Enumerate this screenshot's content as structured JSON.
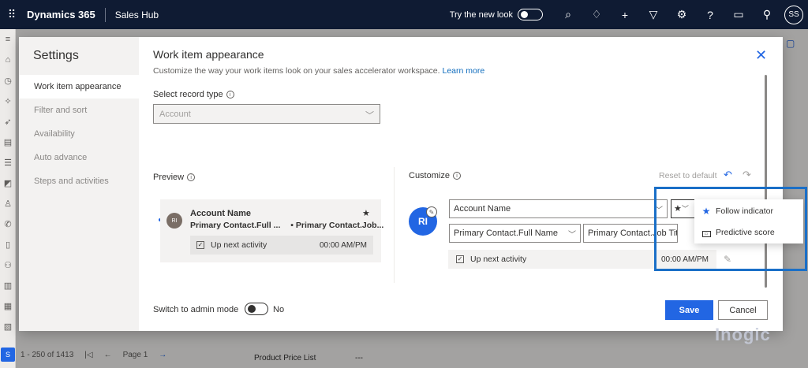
{
  "topbar": {
    "app_name": "Dynamics 365",
    "area_name": "Sales Hub",
    "try_new_look": "Try the new look",
    "user_initials": "SS"
  },
  "background": {
    "pager": {
      "range": "1 - 250 of 1413",
      "page": "Page 1"
    },
    "field_label": "Product Price List",
    "field_value": "---"
  },
  "watermark": "inogic",
  "dialog": {
    "nav_title": "Settings",
    "nav_items": [
      {
        "label": "Work item appearance",
        "active": true
      },
      {
        "label": "Filter and sort",
        "active": false
      },
      {
        "label": "Availability",
        "active": false
      },
      {
        "label": "Auto advance",
        "active": false
      },
      {
        "label": "Steps and activities",
        "active": false
      }
    ],
    "title": "Work item appearance",
    "subtitle": "Customize the way your work items look on your sales accelerator workspace.",
    "learn_more": "Learn more",
    "record_type_label": "Select record type",
    "record_type_value": "Account",
    "preview": {
      "label": "Preview",
      "avatar": "RI",
      "name": "Account Name",
      "line2_a": "Primary Contact.Full ...",
      "line2_b": "• Primary Contact.Job...",
      "activity": "Up next activity",
      "time": "00:00 AM/PM"
    },
    "customize": {
      "label": "Customize",
      "reset": "Reset to default",
      "avatar": "RI",
      "field_primary": "Account Name",
      "field_secondary_a": "Primary Contact.Full Name",
      "field_secondary_b": "Primary Contact.Job Title",
      "activity": "Up next activity",
      "time": "00:00 AM/PM"
    },
    "admin_mode_label": "Switch to admin mode",
    "admin_mode_value": "No",
    "save": "Save",
    "cancel": "Cancel"
  },
  "popup": {
    "items": [
      {
        "label": "Follow indicator",
        "icon": "star-icon"
      },
      {
        "label": "Predictive score",
        "icon": "score-card-icon"
      }
    ]
  },
  "colors": {
    "accent": "#2266e3",
    "topbar": "#0f1b33",
    "highlight": "#1a6fc7"
  }
}
